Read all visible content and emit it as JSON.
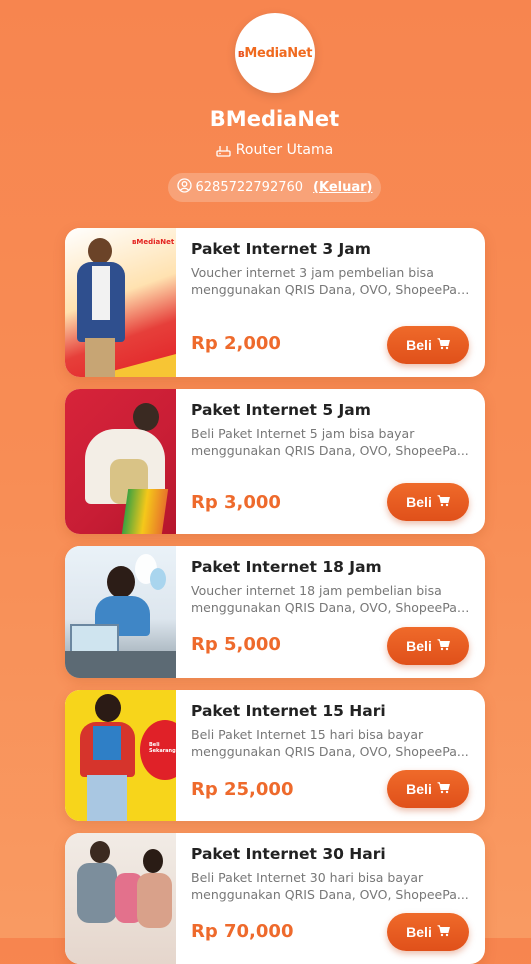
{
  "header": {
    "logo_text": "MediaNet",
    "brand_title": "BMediaNet",
    "router_label": "Router Utama",
    "phone": "6285722792760",
    "logout_label": "(Keluar)"
  },
  "products": [
    {
      "title": "Paket Internet 3 Jam",
      "desc_line1": "Voucher internet 3 jam pembelian bisa",
      "desc_line2": "menggunakan QRIS Dana, OVO, ShopeePay...",
      "price": "Rp 2,000",
      "buy_label": "Beli"
    },
    {
      "title": "Paket Internet 5 Jam",
      "desc_line1": "Beli Paket Internet 5 jam bisa bayar",
      "desc_line2": "menggunakan QRIS Dana, OVO, ShopeePa...",
      "price": "Rp 3,000",
      "buy_label": "Beli"
    },
    {
      "title": "Paket Internet 18 Jam",
      "desc_line1": "Voucher internet 18 jam pembelian bisa",
      "desc_line2": "menggunakan QRIS Dana, OVO, ShopeePay...",
      "price": "Rp 5,000",
      "buy_label": "Beli"
    },
    {
      "title": "Paket Internet 15 Hari",
      "desc_line1": "Beli Paket Internet 15 hari bisa bayar",
      "desc_line2": "menggunakan QRIS Dana, OVO, ShopeePa...",
      "price": "Rp 25,000",
      "buy_label": "Beli"
    },
    {
      "title": "Paket Internet 30 Hari",
      "desc_line1": "Beli Paket Internet 30 hari bisa bayar",
      "desc_line2": "menggunakan QRIS Dana, OVO, ShopeePa...",
      "price": "Rp 70,000",
      "buy_label": "Beli"
    }
  ],
  "colors": {
    "accent": "#ee6a2c",
    "background": "#f7854f",
    "card": "#ffffff"
  },
  "icons": {
    "router": "router-icon",
    "user": "user-circle-icon",
    "cart": "cart-icon"
  }
}
